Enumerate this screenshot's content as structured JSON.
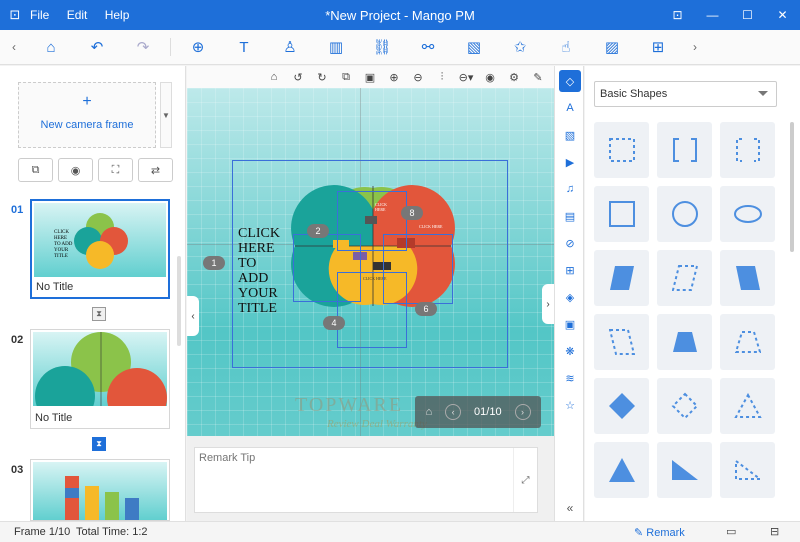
{
  "window": {
    "app_icon": "mango-pm-icon",
    "title": "*New Project - Mango PM",
    "menu": [
      "File",
      "Edit",
      "Help"
    ],
    "controls": {
      "pin": "⊡",
      "minimize": "—",
      "maximize": "☐",
      "close": "✕"
    }
  },
  "toolbar": {
    "left_arrow": "‹",
    "right_arrow": "›",
    "icons": [
      "home-icon",
      "undo-icon",
      "redo-icon",
      "add-icon",
      "text-icon",
      "person-icon",
      "chart-icon",
      "diagram-icon",
      "link-icon",
      "image-icon",
      "star-icon",
      "touch-icon",
      "background-icon",
      "more-icon"
    ],
    "glyphs": [
      "⌂",
      "↶",
      "↷",
      "⊕",
      "T",
      "♙",
      "▥",
      "⛓",
      "⚯",
      "▧",
      "✩",
      "☝",
      "▨",
      "⊞"
    ]
  },
  "left_panel": {
    "camera_frame_label": "New camera frame",
    "camera_frame_symbol": "+",
    "frames": [
      {
        "number": "01",
        "name": "No Title",
        "selected": true
      },
      {
        "number": "02",
        "name": "No Title",
        "selected": false
      },
      {
        "number": "03",
        "name": "",
        "selected": false
      }
    ]
  },
  "canvas": {
    "title_text_lines": [
      "CLICK",
      "HERE",
      "TO",
      "ADD",
      "YOUR",
      "TITLE"
    ],
    "petal_text": "CLICK HERE TO ADD TITLE",
    "badges": [
      "1",
      "2",
      "4",
      "6",
      "8"
    ],
    "nav_counter": "01/10",
    "watermark": "TOPWARE",
    "watermark_sub": "Review Deal Warranty"
  },
  "remark": {
    "placeholder": "Remark Tip"
  },
  "right_panel": {
    "category": "Basic Shapes",
    "shape_color": "#4d8fe0"
  },
  "status": {
    "frame": "Frame 1/10",
    "total_time": "Total Time: 1:2",
    "remark_label": "Remark"
  }
}
